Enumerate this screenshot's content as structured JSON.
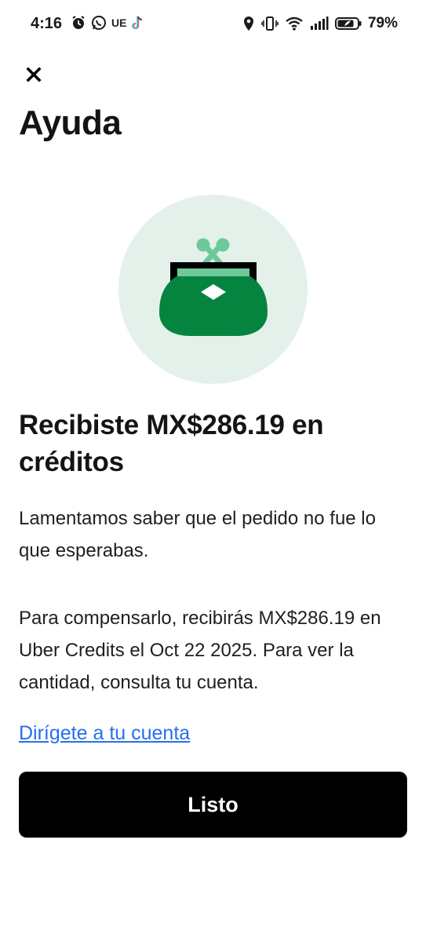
{
  "status_bar": {
    "time": "4:16",
    "carrier_badge": "UE",
    "battery_percent": "79%",
    "icons": [
      "alarm-icon",
      "whatsapp-icon",
      "tiktok-icon",
      "location-icon",
      "vibrate-icon",
      "wifi-icon",
      "signal-icon",
      "battery-icon"
    ]
  },
  "header": {
    "close_icon": "close-icon",
    "title": "Ayuda"
  },
  "illustration": {
    "icon": "wallet-icon",
    "colors": {
      "circle_bg": "#e4f1ea",
      "purse_body": "#05843f",
      "clasp": "#6dc99a",
      "frame": "#000000"
    }
  },
  "content": {
    "heading": "Recibiste MX$286.19 en créditos",
    "paragraph_1": "Lamentamos saber que el pedido no fue lo que esperabas.",
    "paragraph_2": "Para compensarlo, recibirás MX$286.19 en Uber Credits el Oct 22 2025. Para ver la cantidad, consulta tu cuenta.",
    "account_link": "Dirígete a tu cuenta",
    "done_button": "Listo"
  },
  "colors": {
    "link": "#276ef1",
    "button_bg": "#000000",
    "button_text": "#ffffff"
  }
}
